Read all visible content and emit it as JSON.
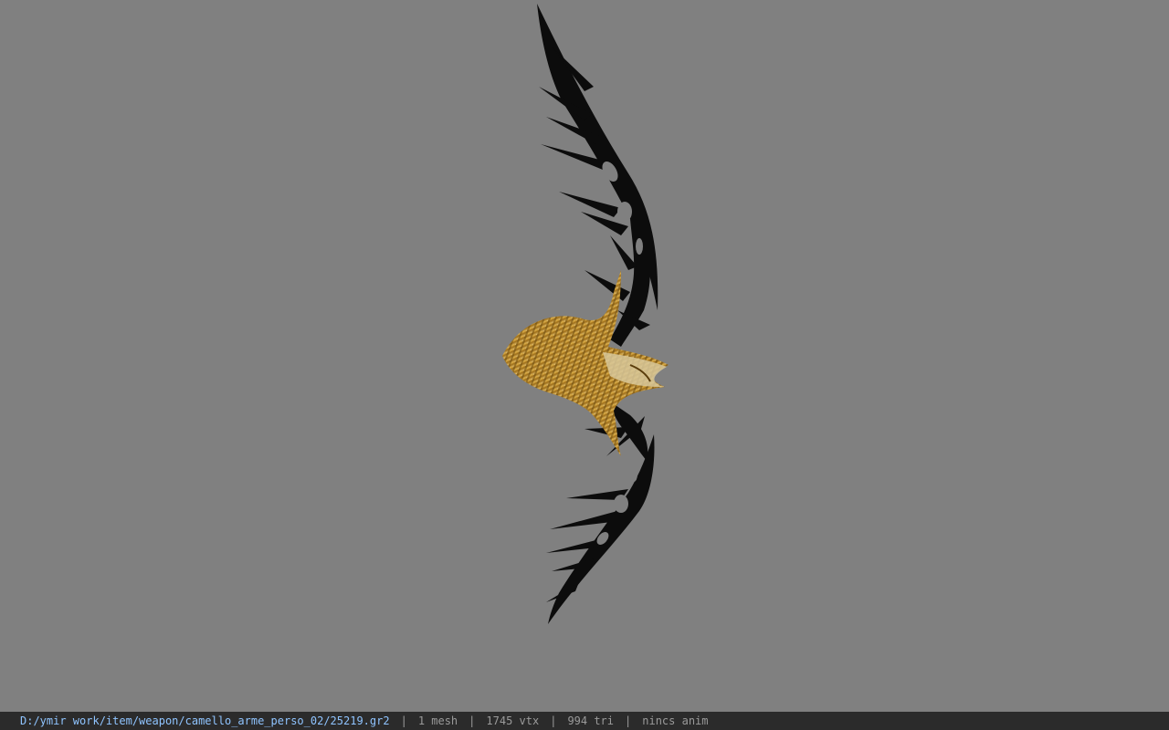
{
  "status_bar": {
    "file_path": "D:/ymir work/item/weapon/camello_arme_perso_02/25219.gr2",
    "separator": "|",
    "mesh_count": "1 mesh",
    "vertex_count": "1745 vtx",
    "triangle_count": "994 tri",
    "animation": "nincs anim"
  },
  "colors": {
    "background": "#808080",
    "status_bar_bg": "#2b2b2b",
    "path_text": "#8fc4ff",
    "info_text": "#9a9a9a",
    "limb": "#0c0c0c",
    "grip_gold": "#b8892a"
  }
}
